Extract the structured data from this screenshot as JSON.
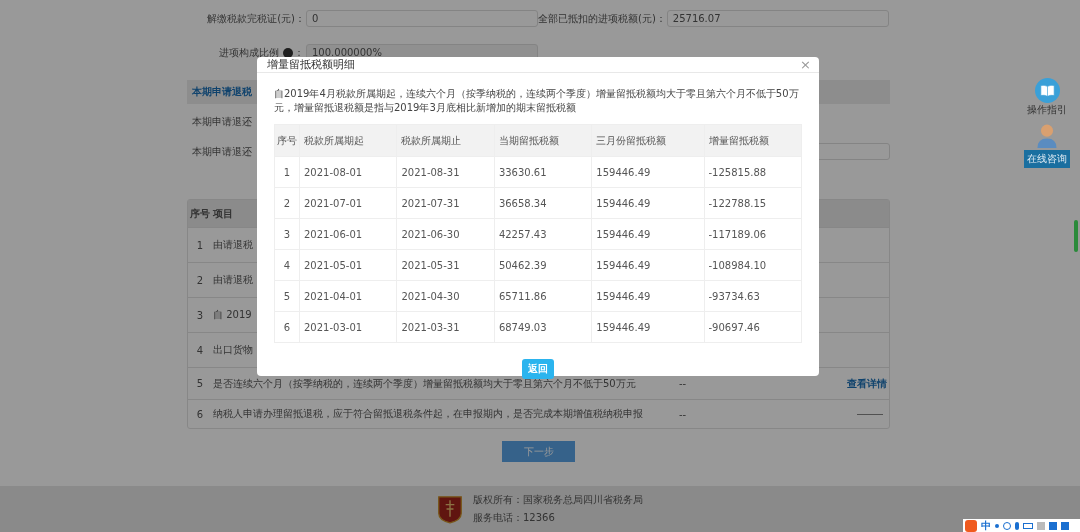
{
  "form": {
    "fields": [
      {
        "label": "解缴税款完税证(元)",
        "separator": "：",
        "value": "0"
      },
      {
        "label": "全部已抵扣的进项税额(元)",
        "separator": "：",
        "value": "25716.07"
      },
      {
        "label": "进项构成比例",
        "help": true,
        "separator": "：",
        "value": "100.000000%"
      }
    ]
  },
  "section": {
    "title": "本期申请退税",
    "labels": [
      "本期申请退还",
      "本期申请退还"
    ]
  },
  "table": {
    "columns": [
      "序号",
      "项目"
    ],
    "rows": [
      {
        "no": "1",
        "item": "由请退税"
      },
      {
        "no": "2",
        "item": "由请退税"
      },
      {
        "no": "3",
        "item": "自 2019"
      },
      {
        "no": "4",
        "item": "出口货物"
      },
      {
        "no": "5",
        "item": "是否连续六个月（按季纳税的，连续两个季度）增量留抵税额均大于零且第六个月不低于50万元",
        "value": "--",
        "kind": "link",
        "action": "查看详情"
      },
      {
        "no": "6",
        "item": "纳税人申请办理留抵退税，应于符合留抵退税条件起，在申报期内，是否完成本期增值税纳税申报",
        "value": "--",
        "kind": "line"
      }
    ]
  },
  "next_button": "下一步",
  "side": {
    "guide": "操作指引",
    "consult": "在线咨询"
  },
  "footer": {
    "lines": [
      "版权所有：国家税务总局四川省税务局",
      "服务电话：12366"
    ]
  },
  "ime": {
    "mode": "中"
  },
  "modal": {
    "title": "增量留抵税额明细",
    "close": "×",
    "note": "自2019年4月税款所属期起，连续六个月（按季纳税的，连续两个季度）增量留抵税额均大于零且第六个月不低于50万元，增量留抵退税额是指与2019年3月底相比新增加的期末留抵税额",
    "columns": [
      "序号",
      "税款所属期起",
      "税款所属期止",
      "当期留抵税额",
      "三月份留抵税额",
      "增量留抵税额"
    ],
    "rows": [
      [
        "1",
        "2021-08-01",
        "2021-08-31",
        "33630.61",
        "159446.49",
        "-125815.88"
      ],
      [
        "2",
        "2021-07-01",
        "2021-07-31",
        "36658.34",
        "159446.49",
        "-122788.15"
      ],
      [
        "3",
        "2021-06-01",
        "2021-06-30",
        "42257.43",
        "159446.49",
        "-117189.06"
      ],
      [
        "4",
        "2021-05-01",
        "2021-05-31",
        "50462.39",
        "159446.49",
        "-108984.10"
      ],
      [
        "5",
        "2021-04-01",
        "2021-04-30",
        "65711.86",
        "159446.49",
        "-93734.63"
      ],
      [
        "6",
        "2021-03-01",
        "2021-03-31",
        "68749.03",
        "159446.49",
        "-90697.46"
      ]
    ],
    "button": "返回"
  }
}
